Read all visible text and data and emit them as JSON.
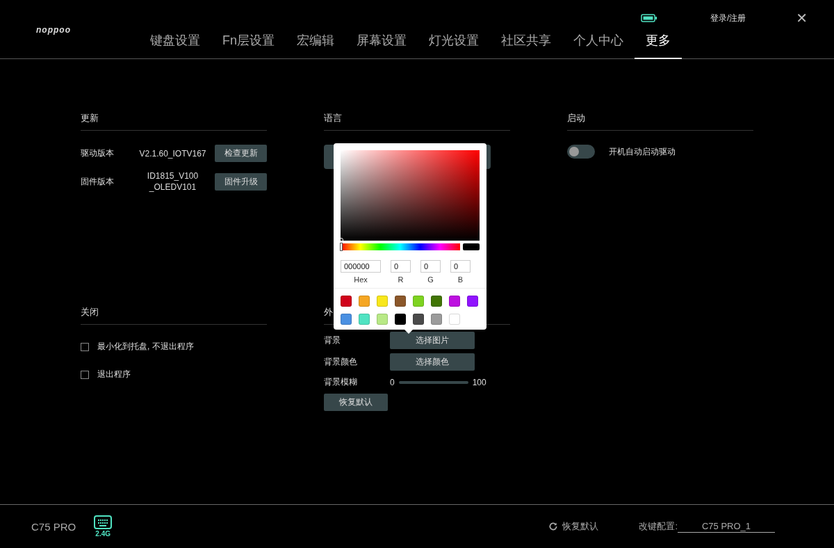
{
  "header": {
    "logo": "noppoo",
    "login": "登录/注册",
    "close": "✕"
  },
  "tabs": [
    {
      "label": "键盘设置",
      "selected": false
    },
    {
      "label": "Fn层设置",
      "selected": false
    },
    {
      "label": "宏编辑",
      "selected": false
    },
    {
      "label": "屏幕设置",
      "selected": false
    },
    {
      "label": "灯光设置",
      "selected": false
    },
    {
      "label": "社区共享",
      "selected": false
    },
    {
      "label": "个人中心",
      "selected": false
    },
    {
      "label": "更多",
      "selected": true
    }
  ],
  "update": {
    "title": "更新",
    "rows": [
      {
        "label": "驱动版本",
        "value": "V2.1.60_IOTV167",
        "button": "检查更新"
      },
      {
        "label": "固件版本",
        "value": "ID1815_V100\n_OLEDV101",
        "button": "固件升级"
      }
    ]
  },
  "language": {
    "title": "语言"
  },
  "startup": {
    "title": "启动",
    "toggle": {
      "label": "开机自动启动驱动",
      "on": false
    }
  },
  "close_section": {
    "title": "关闭",
    "options": [
      {
        "label": "最小化到托盘, 不退出程序",
        "checked": false
      },
      {
        "label": "退出程序",
        "checked": false
      }
    ]
  },
  "appearance": {
    "title": "外",
    "rows": [
      {
        "kind": "button",
        "label": "背景",
        "button": "选择图片"
      },
      {
        "kind": "button",
        "label": "背景颜色",
        "button": "选择颜色"
      },
      {
        "kind": "slider",
        "label": "背景模糊",
        "min": "0",
        "max": "100",
        "level": 0
      }
    ],
    "reset": "恢复默认"
  },
  "color_picker": {
    "hue": {
      "level": 0
    },
    "hex": "000000",
    "r": "0",
    "g": "0",
    "b": "0",
    "hex_label": "Hex",
    "r_label": "R",
    "g_label": "G",
    "b_label": "B",
    "swatches": [
      {
        "color": "#d0021b"
      },
      {
        "color": "#f5a623"
      },
      {
        "color": "#f8e71c"
      },
      {
        "color": "#8b572a"
      },
      {
        "color": "#7ed321"
      },
      {
        "color": "#417505"
      },
      {
        "color": "#bd10e0"
      },
      {
        "color": "#9013fe"
      },
      {
        "color": "#4a90e2"
      },
      {
        "color": "#50e3c2"
      },
      {
        "color": "#b8e986"
      },
      {
        "color": "#000000"
      },
      {
        "color": "#4a4a4a"
      },
      {
        "color": "#9b9b9b"
      },
      {
        "color": "#ffffff"
      }
    ]
  },
  "footer": {
    "device": "C75 PRO",
    "connection": "2.4G",
    "reset": "恢复默认",
    "config_label": "改键配置:",
    "config_value": "C75 PRO_1"
  }
}
